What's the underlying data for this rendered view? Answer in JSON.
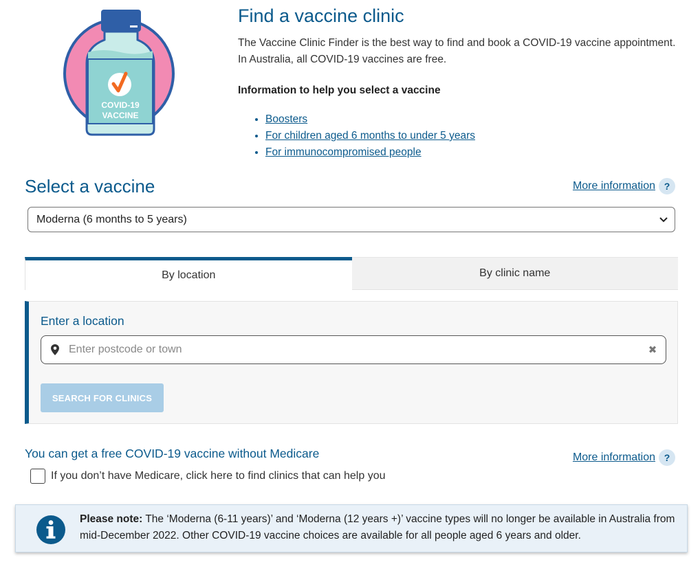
{
  "hero": {
    "bottle_label_line1": "COVID-19",
    "bottle_label_line2": "VACCINE",
    "title": "Find a vaccine clinic",
    "intro": "The Vaccine Clinic Finder is the best way to find and book a COVID-19 vaccine appointment. In Australia, all COVID-19 vaccines are free.",
    "info_heading": "Information to help you select a vaccine",
    "links": [
      "Boosters",
      "For children aged 6 months to under 5 years",
      "For immunocompromised people"
    ]
  },
  "select_vaccine": {
    "title": "Select a vaccine",
    "more_info": "More information",
    "help_glyph": "?",
    "selected": "Moderna (6 months to 5 years)"
  },
  "tabs": [
    {
      "label": "By location",
      "active": true
    },
    {
      "label": "By clinic name",
      "active": false
    }
  ],
  "location": {
    "label": "Enter a location",
    "placeholder": "Enter postcode or town",
    "value": "",
    "search_button": "SEARCH FOR CLINICS"
  },
  "medicare": {
    "title": "You can get a free COVID-19 vaccine without Medicare",
    "more_info": "More information",
    "help_glyph": "?",
    "checkbox_label": "If you don’t have Medicare, click here to find clinics that can help you",
    "checked": false
  },
  "note": {
    "prefix": "Please note:",
    "text": " The ‘Moderna (6-11 years)’ and ‘Moderna (12 years +)’ vaccine types will no longer be available in Australia from mid-December 2022. Other COVID-19 vaccine choices are available for all people aged 6 years and older."
  },
  "colors": {
    "brand_blue": "#0b5a8c",
    "button_disabled": "#a9cde6",
    "note_bg": "#e9f1f8"
  }
}
